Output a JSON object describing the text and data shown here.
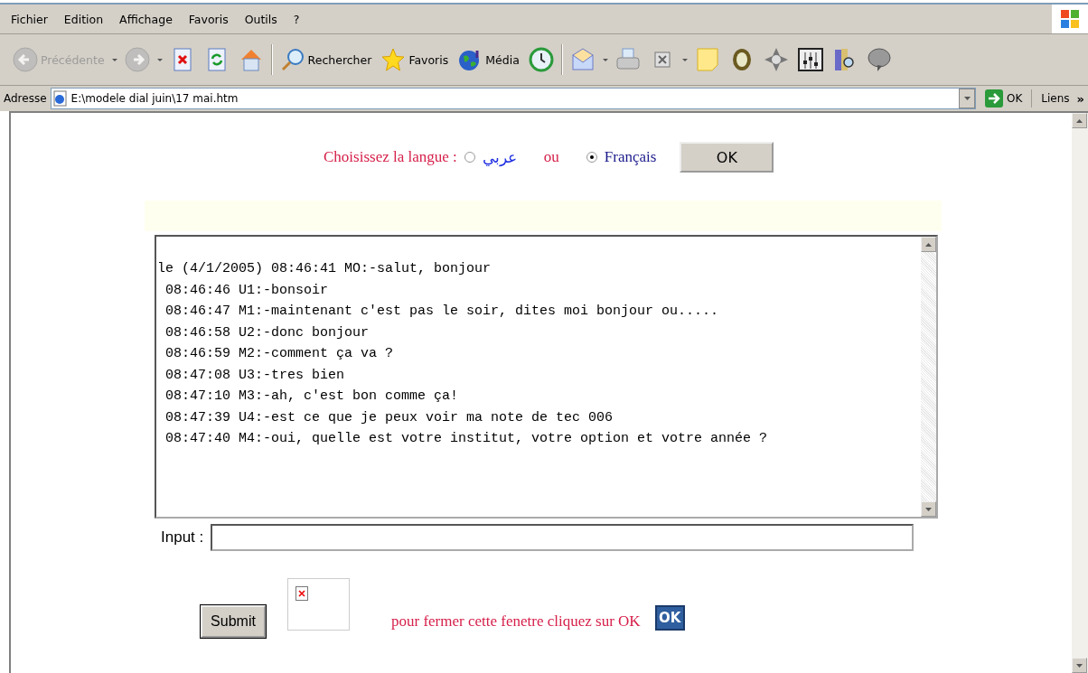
{
  "menu": [
    "Fichier",
    "Edition",
    "Affichage",
    "Favoris",
    "Outils",
    "?"
  ],
  "toolbar": [
    {
      "kind": "back",
      "label": "Précédente",
      "disabled": true
    },
    {
      "kind": "forward",
      "disabled": true
    },
    {
      "kind": "stop"
    },
    {
      "kind": "refresh"
    },
    {
      "kind": "home"
    },
    {
      "kind": "sep"
    },
    {
      "kind": "search",
      "label": "Rechercher"
    },
    {
      "kind": "favorites",
      "label": "Favoris"
    },
    {
      "kind": "media",
      "label": "Média"
    },
    {
      "kind": "history"
    },
    {
      "kind": "sep"
    },
    {
      "kind": "mail"
    },
    {
      "kind": "print"
    },
    {
      "kind": "edit"
    },
    {
      "kind": "note"
    },
    {
      "kind": "gem"
    },
    {
      "kind": "gear"
    },
    {
      "kind": "mixer"
    },
    {
      "kind": "books"
    },
    {
      "kind": "bubble"
    }
  ],
  "address": {
    "label": "Adresse",
    "value": "E:\\modele dial juin\\17  mai.htm",
    "go": "OK",
    "links": "Liens",
    "more": "»"
  },
  "language": {
    "prompt": "Choisissez la langue :",
    "options": [
      {
        "label": "عربي",
        "selected": false
      },
      {
        "label": "Français",
        "selected": true
      }
    ],
    "separator": "ou",
    "button": "OK"
  },
  "chat": [
    {
      "text": "le (4/1/2005) 08:46:41 MO:-salut, bonjour"
    },
    {
      "text": " 08:46:46 U1:-bonsoir"
    },
    {
      "text": " 08:46:47 M1:-maintenant c'est pas le soir, dites moi bonjour ou....."
    },
    {
      "text": " 08:46:58 U2:-donc bonjour"
    },
    {
      "text": " 08:46:59 M2:-comment ça va ?"
    },
    {
      "text": " 08:47:08 U3:-tres bien"
    },
    {
      "text": " 08:47:10 M3:-ah, c'est bon comme ça!"
    },
    {
      "text": " 08:47:39 U4:-est ce que je peux voir ma note de tec 006"
    },
    {
      "text": " 08:47:40 M4:-oui, quelle est votre institut, votre option et votre année ?"
    }
  ],
  "input": {
    "label": "Input :"
  },
  "submit": "Submit",
  "close": {
    "text": "pour fermer cette fenetre cliquez sur OK",
    "button": "OK"
  }
}
